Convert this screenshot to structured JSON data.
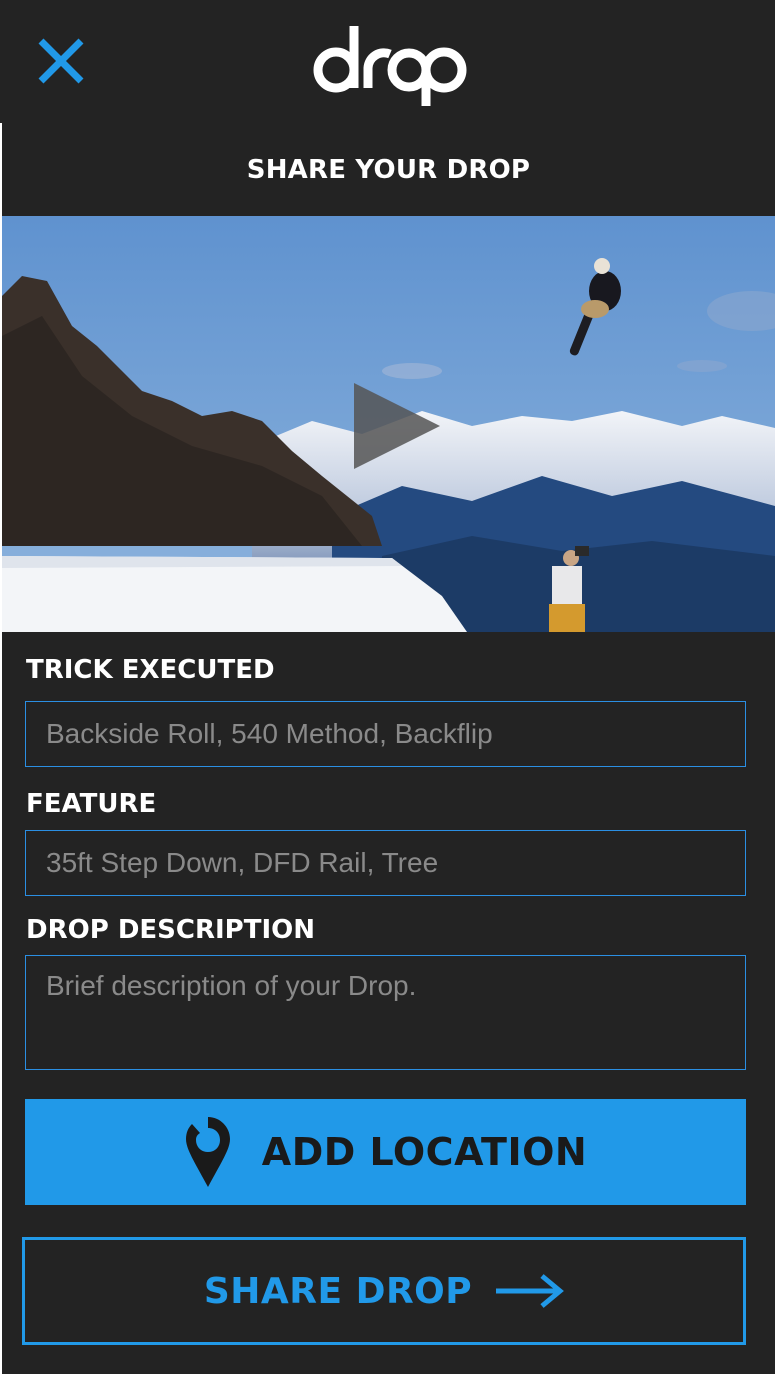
{
  "header": {
    "app_name": "drop",
    "close_icon": "close-icon",
    "accent": "#2199e8"
  },
  "share": {
    "title": "SHARE YOUR DROP"
  },
  "media": {
    "play_icon": "play-icon"
  },
  "form": {
    "trick": {
      "label": "TRICK EXECUTED",
      "placeholder": "Backside Roll, 540 Method, Backflip"
    },
    "feature": {
      "label": "FEATURE",
      "placeholder": "35ft Step Down, DFD Rail, Tree"
    },
    "description": {
      "label": "DROP DESCRIPTION",
      "placeholder": "Brief description of your Drop."
    }
  },
  "actions": {
    "add_location": {
      "label": "ADD LOCATION",
      "icon": "location-pin-icon"
    },
    "share_drop": {
      "label": "SHARE DROP",
      "icon": "arrow-right-icon"
    }
  },
  "colors": {
    "background": "#232323",
    "accent": "#2199e8",
    "text": "#ffffff"
  }
}
